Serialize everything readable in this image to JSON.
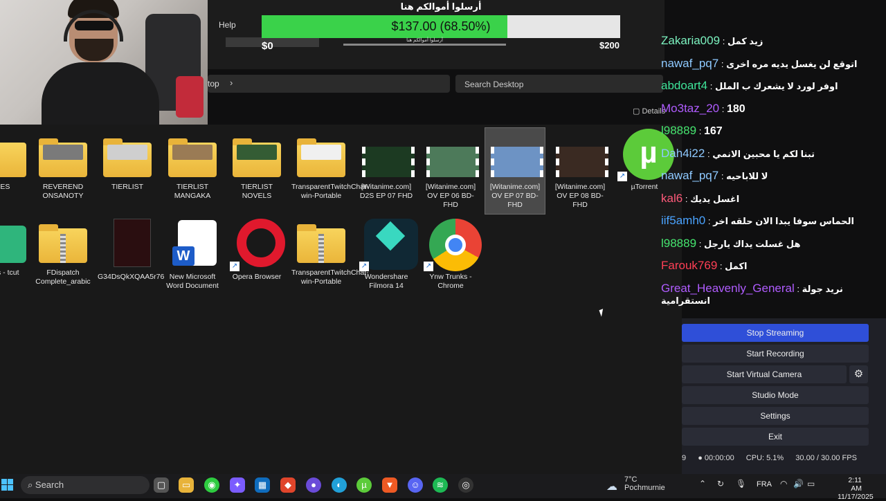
{
  "menu": {
    "help": "Help"
  },
  "donation": {
    "title": "أرسلوا أموالكم هنا",
    "amount_text": "$137.00 (68.50%)",
    "progress": 0.685,
    "min": "$0",
    "max": "$200",
    "mini_title": "أرسلوا أموالكم هنا"
  },
  "explorer": {
    "address": "top",
    "search_placeholder": "Search Desktop",
    "details": "Details"
  },
  "files_row1": [
    {
      "label": "MES"
    },
    {
      "label": "REVEREND ONSANOTY"
    },
    {
      "label": "TIERLIST"
    },
    {
      "label": "TIERLIST MANGAKA"
    },
    {
      "label": "TIERLIST NOVELS"
    },
    {
      "label": "TransparentTwitchChat-win-Portable"
    },
    {
      "label": "[Witanime.com] D2S EP 07 FHD"
    },
    {
      "label": "[Witanime.com] OV EP 06 BD-FHD"
    },
    {
      "label": "[Witanime.com] OV EP 07 BD-FHD"
    },
    {
      "label": "[Witanime.com] OV EP 08 BD-FHD"
    },
    {
      "label": "µTorrent"
    }
  ],
  "files_row2": [
    {
      "label": "oads - tcut"
    },
    {
      "label": "FDispatch Complete_arabic"
    },
    {
      "label": "G34DsQkXQAA5r76"
    },
    {
      "label": "New Microsoft Word Document"
    },
    {
      "label": "Opera Browser"
    },
    {
      "label": "TransparentTwitchChat-win-Portable"
    },
    {
      "label": "Wondershare Filmora 14"
    },
    {
      "label": "Ynw Trunks - Chrome"
    }
  ],
  "chat": [
    {
      "user": "Zakaria009",
      "color": "#7cf3c0",
      "msg": "زيد كمل"
    },
    {
      "user": "nawaf_pq7",
      "color": "#8ec9ff",
      "msg": "اتوقع لن يغسل يديه مره اخرى"
    },
    {
      "user": "abdoart4",
      "color": "#3fe59a",
      "msg": "اوفر لورد لا يشعرك ب الملل"
    },
    {
      "user": "Mo3taz_20",
      "color": "#b05cff",
      "msg": "180"
    },
    {
      "user": "l98889",
      "color": "#46e56f",
      "msg": "167"
    },
    {
      "user": "Dah4i22",
      "color": "#8ec9ff",
      "msg": "تبنا لكم يا محبين الانمي"
    },
    {
      "user": "nawaf_pq7",
      "color": "#8ec9ff",
      "msg": "لا للاباحيه"
    },
    {
      "user": "kal6",
      "color": "#ff5a7a",
      "msg": "اغسل يديك"
    },
    {
      "user": "iif5amh0",
      "color": "#4aa3ff",
      "msg": "الحماس سوفا يبدا الان حلقه اخر"
    },
    {
      "user": "l98889",
      "color": "#46e56f",
      "msg": "هل غسلت يداك يارجل"
    },
    {
      "user": "Farouk769",
      "color": "#ff3f55",
      "msg": "اكمل"
    },
    {
      "user": "Great_Heavenly_General",
      "color": "#b05cff",
      "msg": "نريد جولة انستقرامية"
    }
  ],
  "obs": {
    "stop_streaming": "Stop Streaming",
    "start_recording": "Start Recording",
    "start_virtual_camera": "Start Virtual Camera",
    "studio_mode": "Studio Mode",
    "settings": "Settings",
    "exit": "Exit",
    "time": "00:00:00",
    "cpu": "CPU: 5.1%",
    "fps": "30.00 / 30.00 FPS",
    "dropped": "9"
  },
  "taskbar": {
    "search": "Search",
    "weather_temp": "7°C",
    "weather_loc": "Pochmurnie",
    "lang": "FRA",
    "time": "2:11 AM",
    "date": "11/17/2025"
  }
}
